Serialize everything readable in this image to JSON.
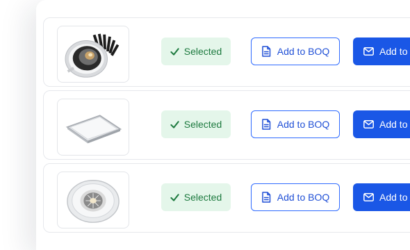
{
  "products": [
    {
      "image_icon": "recessed-downlight-product-image",
      "status_label": "Selected",
      "boq_label": "Add to BOQ",
      "email_label": "Add to"
    },
    {
      "image_icon": "square-panel-light-product-image",
      "status_label": "Selected",
      "boq_label": "Add to BOQ",
      "email_label": "Add to"
    },
    {
      "image_icon": "round-downlight-product-image",
      "status_label": "Selected",
      "boq_label": "Add to BOQ",
      "email_label": "Add to"
    }
  ],
  "colors": {
    "selected_bg": "#e4f6ea",
    "selected_text": "#1d7a3f",
    "outline_blue": "#2f6bff",
    "primary_blue": "#1a57e6"
  }
}
